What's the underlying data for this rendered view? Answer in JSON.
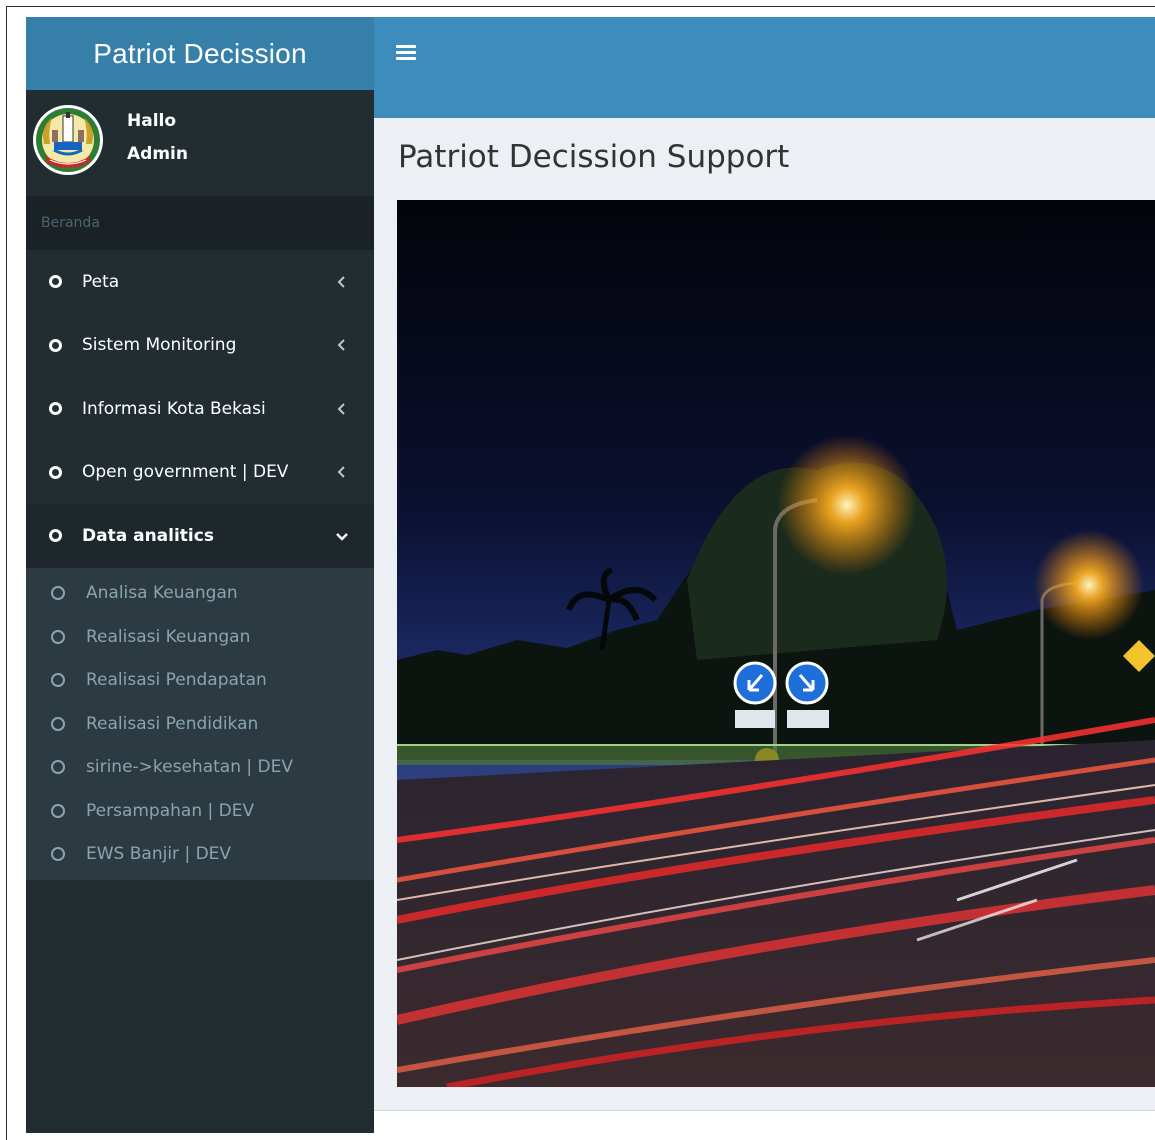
{
  "app": {
    "brand": "Patriot Decission"
  },
  "user_panel": {
    "greeting": "Hallo",
    "name": "Admin"
  },
  "sidebar": {
    "section_header": "Beranda",
    "items": [
      {
        "label": "Peta",
        "icon": "circle-o-icon",
        "expanded": false
      },
      {
        "label": "Sistem Monitoring",
        "icon": "circle-o-icon",
        "expanded": false
      },
      {
        "label": "Informasi Kota Bekasi",
        "icon": "circle-o-icon",
        "expanded": false
      },
      {
        "label": "Open government | DEV",
        "icon": "circle-o-icon",
        "expanded": false
      },
      {
        "label": "Data analitics",
        "icon": "circle-o-icon",
        "expanded": true
      }
    ],
    "submenu": [
      {
        "label": "Analisa Keuangan"
      },
      {
        "label": "Realisasi Keuangan"
      },
      {
        "label": "Realisasi Pendapatan"
      },
      {
        "label": "Realisasi Pendidikan"
      },
      {
        "label": "sirine->kesehatan | DEV"
      },
      {
        "label": "Persampahan | DEV"
      },
      {
        "label": "EWS Banjir | DEV"
      }
    ]
  },
  "header": {
    "menu_toggle_icon": "hamburger-icon"
  },
  "main": {
    "title": "Patriot Decission Support"
  },
  "colors": {
    "header_blue": "#3c8dbc",
    "logo_blue": "#367fa9",
    "sidebar_dark": "#222d32",
    "content_bg": "#ecf0f5"
  }
}
